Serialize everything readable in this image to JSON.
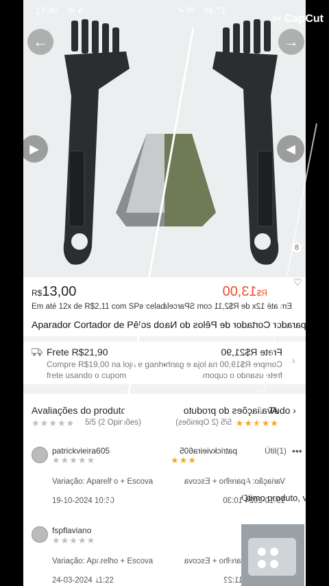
{
  "status_bar": {
    "time": "17:40"
  },
  "watermark": {
    "brand": "CapCut"
  },
  "product": {
    "currency": "R$",
    "price": "13,00",
    "installments": "Em até 12x de R$2,11 com SParcelado",
    "installments_arrow": "›",
    "title": "Aparador Cortador de Pêlos do Nariz Orelha e Barba",
    "title_right": "Aparador Cortador de Pêlos do Nariz",
    "photo_count": "8"
  },
  "shipping": {
    "title": "Frete R$21,90",
    "sub1": "Compre R$19,00 na loja e ganhe até R$20,",
    "sub2": "frete usando o cupom"
  },
  "reviews": {
    "header": "Avaliações do produto",
    "see_all": "Tudo",
    "score": "5/5",
    "count": "(2 Opiniões)",
    "useful_label": "Útil(1)",
    "items": [
      {
        "user": "patrickvieira605",
        "variation": "Variação: Aparelho + Escova",
        "date": "19-10-2024 10:30",
        "text": "Otimo produto, vendedor super"
      },
      {
        "user": "fspflaviano",
        "variation": "Variação: Aparelho + Escova",
        "date": "24-03-2024 11:22",
        "text": ""
      }
    ]
  },
  "icons": {
    "back": "arrow-left-icon",
    "share": "arrow-right-icon",
    "play": "play-icon",
    "truck": "truck-icon",
    "heart": "heart-icon",
    "chevron": "chevron-right-icon",
    "more": "more-dots-icon"
  }
}
